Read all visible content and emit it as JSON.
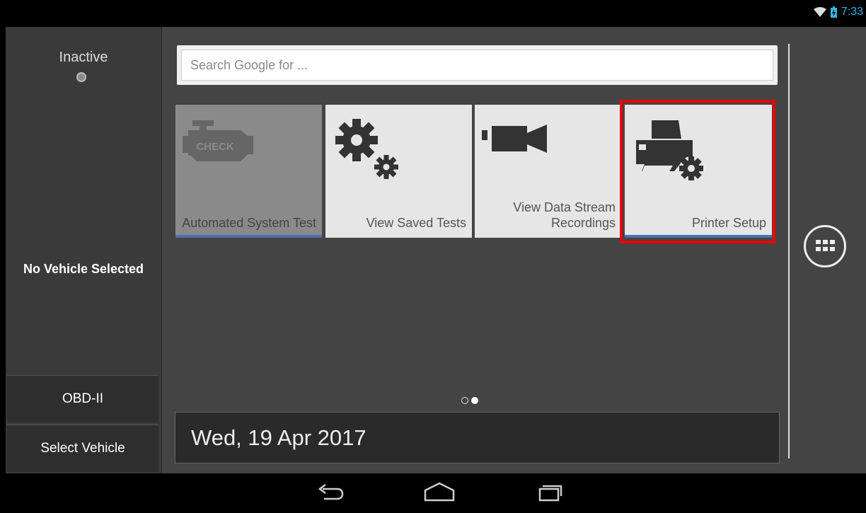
{
  "status": {
    "time": "7:33"
  },
  "sidebar": {
    "status_label": "Inactive",
    "vehicle_status": "No Vehicle Selected",
    "buttons": [
      {
        "label": "OBD-II"
      },
      {
        "label": "Select Vehicle"
      }
    ]
  },
  "search": {
    "placeholder": "Search Google for ..."
  },
  "tiles": [
    {
      "label": "Automated System Test",
      "icon": "check-engine-icon",
      "icon_text": "CHECK"
    },
    {
      "label": "View Saved Tests",
      "icon": "gears-icon"
    },
    {
      "label": "View Data Stream Recordings",
      "icon": "video-camera-icon"
    },
    {
      "label": "Printer Setup",
      "icon": "printer-settings-icon"
    }
  ],
  "date": "Wed, 19 Apr 2017",
  "colors": {
    "accent": "#4a6fb0",
    "highlight": "#e00000",
    "status_blue": "#33b5e5"
  }
}
